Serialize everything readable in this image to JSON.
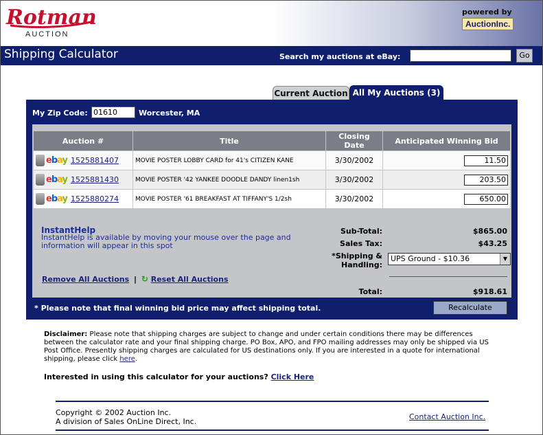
{
  "header": {
    "logo_text": "Rotman",
    "logo_sub": "AUCTION",
    "powered_by": "powered by",
    "powered_brand": "AuctionInc.",
    "brand_color": "#c8102e"
  },
  "titlebar": {
    "title": "Shipping Calculator",
    "search_label": "Search my auctions at eBay:",
    "search_value": "",
    "go_label": "Go"
  },
  "tabs": {
    "current": "Current Auction",
    "all": "All My Auctions (3)"
  },
  "zip": {
    "label": "My Zip Code:",
    "value": "01610",
    "city": "Worcester, MA"
  },
  "table": {
    "headers": [
      "Auction #",
      "Title",
      "Closing Date",
      "Anticipated Winning Bid"
    ],
    "rows": [
      {
        "auction": "1525881407",
        "title": "MOVIE POSTER LOBBY CARD for 41's CITIZEN KANE",
        "date": "3/30/2002",
        "bid": "11.50"
      },
      {
        "auction": "1525881430",
        "title": "MOVIE POSTER '42 YANKEE DOODLE DANDY linen1sh",
        "date": "3/30/2002",
        "bid": "203.50"
      },
      {
        "auction": "1525880274",
        "title": "MOVIE POSTER '61 BREAKFAST AT TIFFANY'S 1/2sh",
        "date": "3/30/2002",
        "bid": "650.00"
      }
    ]
  },
  "instant_help": {
    "title": "InstantHelp",
    "text": "InstantHelp is available by moving your mouse over the page and information will appear in this spot"
  },
  "totals": {
    "subtotal_label": "Sub-Total:",
    "subtotal": "$865.00",
    "tax_label": "Sales Tax:",
    "tax": "$43.25",
    "shipping_label": "*Shipping & Handling:",
    "shipping_value": "UPS Ground - $10.36",
    "total_label": "Total:",
    "total": "$918.61"
  },
  "actions": {
    "remove_all": "Remove All Auctions",
    "separator": "|",
    "reset_all": "Reset All Auctions",
    "recalculate": "Recalculate"
  },
  "note": "* Please note that final winning bid price may affect shipping total.",
  "disclaimer": {
    "label": "Disclaimer:",
    "text": "Please note that shipping charges are subject to change and under certain conditions there may be differences between the calculator rate and your final shipping charge.   PO Box, APO, and FPO mailing addresses may only be shipped via US Post Office.   Presently shipping charges are calculated for US destinations only. If you are interested in a quote for international shipping, please click",
    "link": "here",
    "end": "."
  },
  "interest": {
    "text": "Interested in using this calculator for your auctions?",
    "link": "Click Here"
  },
  "footer": {
    "copyright": "Copyright © 2002 Auction Inc.",
    "division": "A division of Sales OnLine Direct, Inc.",
    "contact": "Contact Auction Inc."
  }
}
